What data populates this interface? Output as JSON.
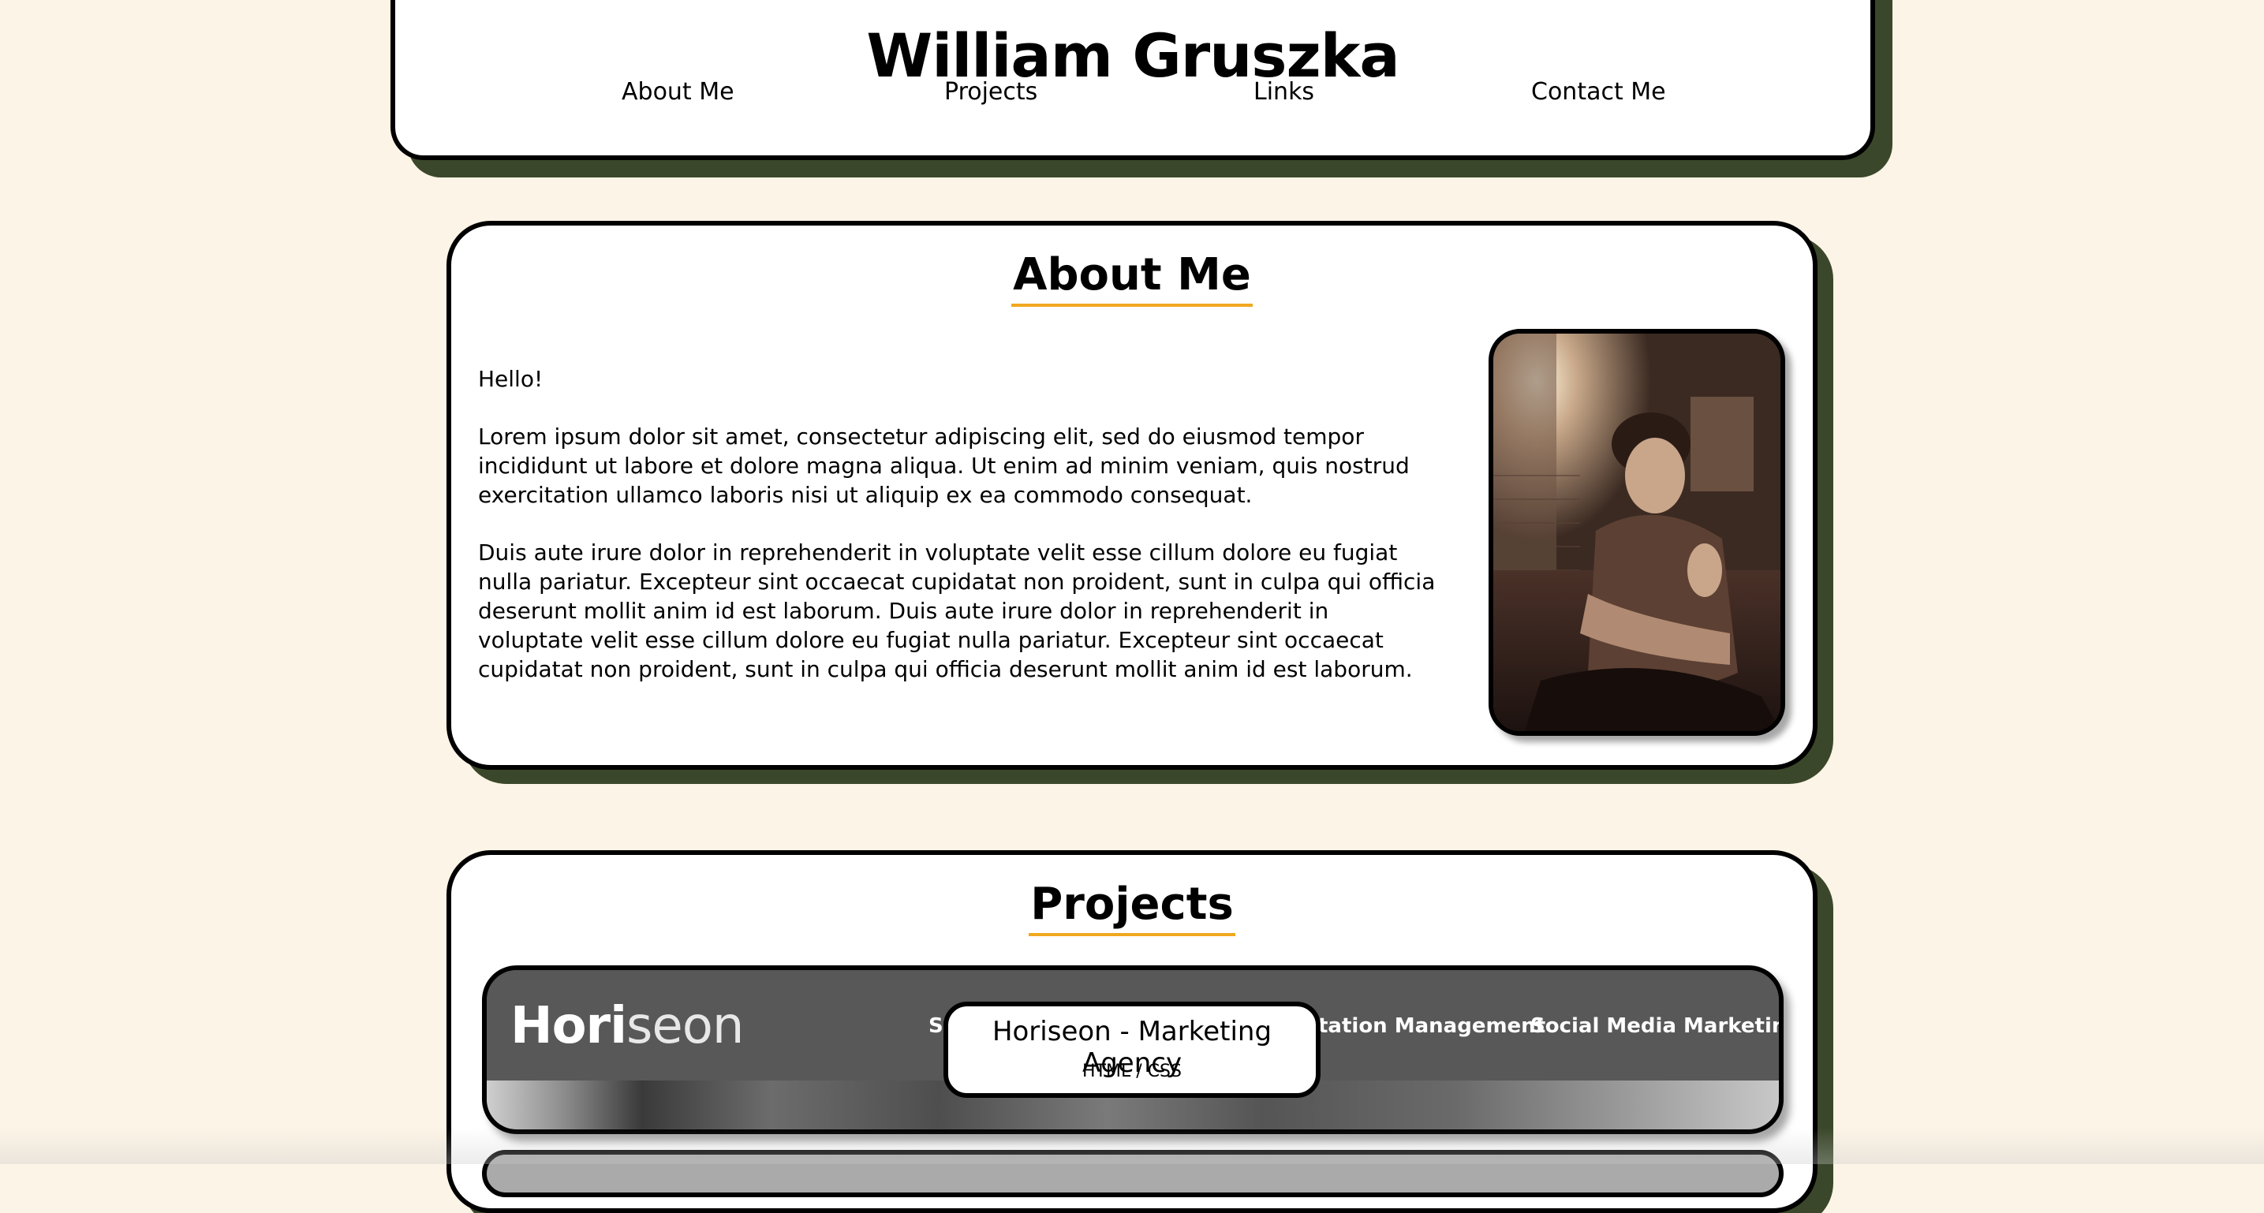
{
  "header": {
    "title": "William Gruszka",
    "nav": [
      {
        "label": "About Me"
      },
      {
        "label": "Projects"
      },
      {
        "label": "Links"
      },
      {
        "label": "Contact Me"
      }
    ]
  },
  "about": {
    "title": "About Me",
    "greeting": "Hello!",
    "paragraph1": "Lorem ipsum dolor sit amet, consectetur adipiscing elit, sed do eiusmod tempor incididunt ut labore et dolore magna aliqua. Ut enim ad minim veniam, quis nostrud exercitation ullamco laboris nisi ut aliquip ex ea commodo consequat.",
    "paragraph2": "Duis aute irure dolor in reprehenderit in voluptate velit esse cillum dolore eu fugiat nulla pariatur. Excepteur sint occaecat cupidatat non proident, sunt in culpa qui officia deserunt mollit anim id est laborum. Duis aute irure dolor in reprehenderit in voluptate velit esse cillum dolore eu fugiat nulla pariatur. Excepteur sint occaecat cupidatat non proident, sunt in culpa qui officia deserunt mollit anim id est laborum."
  },
  "projects": {
    "title": "Projects",
    "items": [
      {
        "name": "Horiseon - Marketing Agency",
        "tech": "HTML / CSS",
        "preview": {
          "logo_bold": "Hori",
          "logo_light": "seon",
          "nav_left": "Se",
          "nav_mid": "tation Management",
          "nav_right": "Social Media Marketing"
        }
      }
    ]
  },
  "colors": {
    "background": "#fcf4e6",
    "shadow": "#3b472a",
    "accent_underline": "#f0a81e"
  }
}
